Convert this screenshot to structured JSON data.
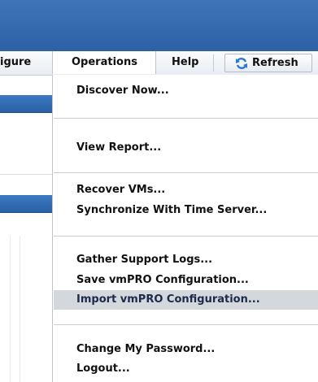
{
  "menubar": {
    "items": [
      {
        "label": "igure"
      },
      {
        "label": "Operations"
      },
      {
        "label": "Help"
      }
    ],
    "refresh_label": "Refresh"
  },
  "operations_menu": {
    "groups": [
      [
        "Discover Now..."
      ],
      [
        "View Report..."
      ],
      [
        "Recover VMs...",
        "Synchronize With Time Server..."
      ],
      [
        "Gather Support Logs...",
        "Save vmPRO Configuration...",
        "Import vmPRO Configuration..."
      ],
      [
        "Change My Password...",
        "Logout..."
      ]
    ],
    "highlighted": "Import vmPRO Configuration..."
  },
  "colors": {
    "title_bar": "#2d61a6",
    "panel_header": "#2a5fa4",
    "highlight": "#d4d7dc"
  },
  "icons": {
    "refresh": "refresh-arrows-icon"
  }
}
